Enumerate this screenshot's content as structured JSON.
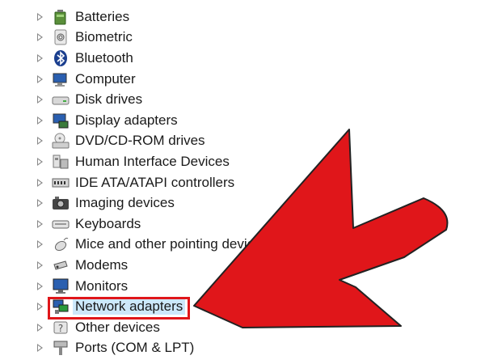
{
  "device_tree": {
    "items": [
      {
        "label": "Batteries",
        "icon": "battery-icon"
      },
      {
        "label": "Biometric",
        "icon": "fingerprint-icon"
      },
      {
        "label": "Bluetooth",
        "icon": "bluetooth-icon"
      },
      {
        "label": "Computer",
        "icon": "computer-icon"
      },
      {
        "label": "Disk drives",
        "icon": "disk-drive-icon"
      },
      {
        "label": "Display adapters",
        "icon": "display-adapter-icon"
      },
      {
        "label": "DVD/CD-ROM drives",
        "icon": "dvd-drive-icon"
      },
      {
        "label": "Human Interface Devices",
        "icon": "hid-icon"
      },
      {
        "label": "IDE ATA/ATAPI controllers",
        "icon": "ide-controller-icon"
      },
      {
        "label": "Imaging devices",
        "icon": "camera-icon"
      },
      {
        "label": "Keyboards",
        "icon": "keyboard-icon"
      },
      {
        "label": "Mice and other pointing devices",
        "icon": "mouse-icon"
      },
      {
        "label": "Modems",
        "icon": "modem-icon"
      },
      {
        "label": "Monitors",
        "icon": "monitor-icon"
      },
      {
        "label": "Network adapters",
        "icon": "network-adapter-icon",
        "selected": true
      },
      {
        "label": "Other devices",
        "icon": "unknown-device-icon"
      },
      {
        "label": "Ports (COM & LPT)",
        "icon": "port-icon"
      }
    ]
  },
  "colors": {
    "highlight_border": "#e0161a",
    "arrow_fill": "#e0161a",
    "selection_background": "#cde8fb"
  }
}
